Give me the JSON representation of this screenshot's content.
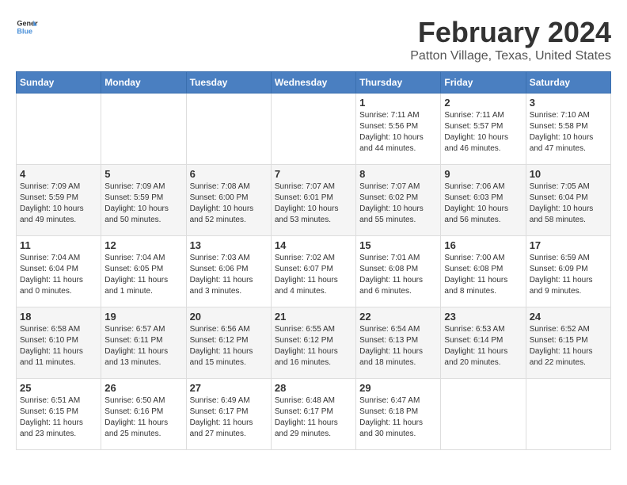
{
  "logo": {
    "line1": "General",
    "line2": "Blue"
  },
  "title": "February 2024",
  "subtitle": "Patton Village, Texas, United States",
  "days_of_week": [
    "Sunday",
    "Monday",
    "Tuesday",
    "Wednesday",
    "Thursday",
    "Friday",
    "Saturday"
  ],
  "weeks": [
    [
      {
        "day": "",
        "sunrise": "",
        "sunset": "",
        "daylight": ""
      },
      {
        "day": "",
        "sunrise": "",
        "sunset": "",
        "daylight": ""
      },
      {
        "day": "",
        "sunrise": "",
        "sunset": "",
        "daylight": ""
      },
      {
        "day": "",
        "sunrise": "",
        "sunset": "",
        "daylight": ""
      },
      {
        "day": "1",
        "sunrise": "7:11 AM",
        "sunset": "5:56 PM",
        "daylight": "10 hours and 44 minutes."
      },
      {
        "day": "2",
        "sunrise": "7:11 AM",
        "sunset": "5:57 PM",
        "daylight": "10 hours and 46 minutes."
      },
      {
        "day": "3",
        "sunrise": "7:10 AM",
        "sunset": "5:58 PM",
        "daylight": "10 hours and 47 minutes."
      }
    ],
    [
      {
        "day": "4",
        "sunrise": "7:09 AM",
        "sunset": "5:59 PM",
        "daylight": "10 hours and 49 minutes."
      },
      {
        "day": "5",
        "sunrise": "7:09 AM",
        "sunset": "5:59 PM",
        "daylight": "10 hours and 50 minutes."
      },
      {
        "day": "6",
        "sunrise": "7:08 AM",
        "sunset": "6:00 PM",
        "daylight": "10 hours and 52 minutes."
      },
      {
        "day": "7",
        "sunrise": "7:07 AM",
        "sunset": "6:01 PM",
        "daylight": "10 hours and 53 minutes."
      },
      {
        "day": "8",
        "sunrise": "7:07 AM",
        "sunset": "6:02 PM",
        "daylight": "10 hours and 55 minutes."
      },
      {
        "day": "9",
        "sunrise": "7:06 AM",
        "sunset": "6:03 PM",
        "daylight": "10 hours and 56 minutes."
      },
      {
        "day": "10",
        "sunrise": "7:05 AM",
        "sunset": "6:04 PM",
        "daylight": "10 hours and 58 minutes."
      }
    ],
    [
      {
        "day": "11",
        "sunrise": "7:04 AM",
        "sunset": "6:04 PM",
        "daylight": "11 hours and 0 minutes."
      },
      {
        "day": "12",
        "sunrise": "7:04 AM",
        "sunset": "6:05 PM",
        "daylight": "11 hours and 1 minute."
      },
      {
        "day": "13",
        "sunrise": "7:03 AM",
        "sunset": "6:06 PM",
        "daylight": "11 hours and 3 minutes."
      },
      {
        "day": "14",
        "sunrise": "7:02 AM",
        "sunset": "6:07 PM",
        "daylight": "11 hours and 4 minutes."
      },
      {
        "day": "15",
        "sunrise": "7:01 AM",
        "sunset": "6:08 PM",
        "daylight": "11 hours and 6 minutes."
      },
      {
        "day": "16",
        "sunrise": "7:00 AM",
        "sunset": "6:08 PM",
        "daylight": "11 hours and 8 minutes."
      },
      {
        "day": "17",
        "sunrise": "6:59 AM",
        "sunset": "6:09 PM",
        "daylight": "11 hours and 9 minutes."
      }
    ],
    [
      {
        "day": "18",
        "sunrise": "6:58 AM",
        "sunset": "6:10 PM",
        "daylight": "11 hours and 11 minutes."
      },
      {
        "day": "19",
        "sunrise": "6:57 AM",
        "sunset": "6:11 PM",
        "daylight": "11 hours and 13 minutes."
      },
      {
        "day": "20",
        "sunrise": "6:56 AM",
        "sunset": "6:12 PM",
        "daylight": "11 hours and 15 minutes."
      },
      {
        "day": "21",
        "sunrise": "6:55 AM",
        "sunset": "6:12 PM",
        "daylight": "11 hours and 16 minutes."
      },
      {
        "day": "22",
        "sunrise": "6:54 AM",
        "sunset": "6:13 PM",
        "daylight": "11 hours and 18 minutes."
      },
      {
        "day": "23",
        "sunrise": "6:53 AM",
        "sunset": "6:14 PM",
        "daylight": "11 hours and 20 minutes."
      },
      {
        "day": "24",
        "sunrise": "6:52 AM",
        "sunset": "6:15 PM",
        "daylight": "11 hours and 22 minutes."
      }
    ],
    [
      {
        "day": "25",
        "sunrise": "6:51 AM",
        "sunset": "6:15 PM",
        "daylight": "11 hours and 23 minutes."
      },
      {
        "day": "26",
        "sunrise": "6:50 AM",
        "sunset": "6:16 PM",
        "daylight": "11 hours and 25 minutes."
      },
      {
        "day": "27",
        "sunrise": "6:49 AM",
        "sunset": "6:17 PM",
        "daylight": "11 hours and 27 minutes."
      },
      {
        "day": "28",
        "sunrise": "6:48 AM",
        "sunset": "6:17 PM",
        "daylight": "11 hours and 29 minutes."
      },
      {
        "day": "29",
        "sunrise": "6:47 AM",
        "sunset": "6:18 PM",
        "daylight": "11 hours and 30 minutes."
      },
      {
        "day": "",
        "sunrise": "",
        "sunset": "",
        "daylight": ""
      },
      {
        "day": "",
        "sunrise": "",
        "sunset": "",
        "daylight": ""
      }
    ]
  ],
  "labels": {
    "sunrise_prefix": "Sunrise: ",
    "sunset_prefix": "Sunset: ",
    "daylight_prefix": "Daylight: "
  }
}
